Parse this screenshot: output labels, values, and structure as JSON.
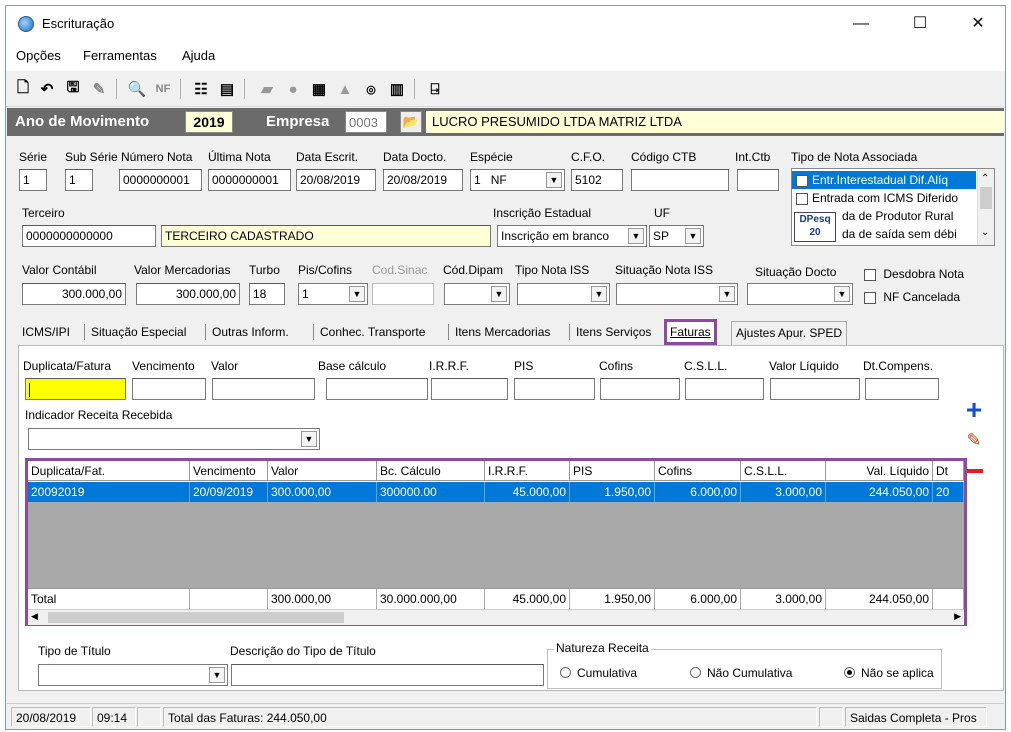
{
  "window": {
    "title": "Escrituração",
    "minimize": "—",
    "maximize": "☐",
    "close": "✕"
  },
  "menu": [
    "Opções",
    "Ferramentas",
    "Ajuda"
  ],
  "yearbar": {
    "ano_label": "Ano de Movimento",
    "ano_value": "2019",
    "empresa_label": "Empresa",
    "empresa_code": "0003",
    "empresa_name": "LUCRO PRESUMIDO LTDA MATRIZ LTDA"
  },
  "header": {
    "serie": {
      "label": "Série",
      "value": "1"
    },
    "sub_serie": {
      "label": "Sub Série",
      "value": "1"
    },
    "numero_nota": {
      "label": "Número Nota",
      "value": "0000000001"
    },
    "ultima_nota": {
      "label": "Última Nota",
      "value": "0000000001"
    },
    "data_escrit": {
      "label": "Data Escrit.",
      "value": "20/08/2019"
    },
    "data_docto": {
      "label": "Data Docto.",
      "value": "20/08/2019"
    },
    "especie": {
      "label": "Espécie",
      "value_code": "1",
      "value_text": "NF"
    },
    "cfo": {
      "label": "C.F.O.",
      "value": "5102"
    },
    "codigo_ctb": {
      "label": "Código CTB",
      "value": ""
    },
    "int_ctb": {
      "label": "Int.Ctb",
      "value": ""
    },
    "tipo_nota": {
      "label": "Tipo de Nota Associada",
      "items": [
        "Entr.Interestadual Dif.Alíq",
        "Entrada com ICMS Diferido",
        "Entrada de Produtor Rural",
        "Entrada de saída sem débi"
      ],
      "item_visible_suffix": [
        "da de Produtor Rural",
        "da de saída sem débi"
      ]
    },
    "dpesq": {
      "line1": "DPesq",
      "line2": "20"
    },
    "terceiro": {
      "label": "Terceiro",
      "code": "0000000000000",
      "name": "TERCEIRO CADASTRADO"
    },
    "inscricao": {
      "label": "Inscrição Estadual",
      "value": "Inscrição em branco"
    },
    "uf": {
      "label": "UF",
      "value": "SP"
    },
    "valor_contabil": {
      "label": "Valor Contábil",
      "value": "300.000,00"
    },
    "valor_mercadorias": {
      "label": "Valor Mercadorias",
      "value": "300.000,00"
    },
    "turbo": {
      "label": "Turbo",
      "value": "18"
    },
    "pis_cofins": {
      "label": "Pis/Cofins",
      "value": "1"
    },
    "cod_sinac": {
      "label": "Cod.Sinac"
    },
    "cod_dipam": {
      "label": "Cód.Dipam"
    },
    "tipo_nota_iss": {
      "label": "Tipo Nota ISS"
    },
    "situacao_nota_iss": {
      "label": "Situação Nota ISS"
    },
    "situacao_docto": {
      "label": "Situação Docto"
    },
    "desdobra_nota": "Desdobra Nota",
    "nf_cancelada": "NF Cancelada"
  },
  "tabs": [
    "ICMS/IPI",
    "Situação Especial",
    "Outras Inform.",
    "Conhec. Transporte",
    "Itens Mercadorias",
    "Itens Serviços",
    "Faturas",
    "Ajustes Apur. SPED"
  ],
  "form": {
    "duplicata": "Duplicata/Fatura",
    "vencimento": "Vencimento",
    "valor": "Valor",
    "base": "Base cálculo",
    "irrf": "I.R.R.F.",
    "pis": "PIS",
    "cofins": "Cofins",
    "csll": "C.S.L.L.",
    "valor_liquido": "Valor Líquido",
    "dt_comp": "Dt.Compens.",
    "indicador": "Indicador Receita Recebida"
  },
  "grid": {
    "columns": [
      "Duplicata/Fat.",
      "Vencimento",
      "Valor",
      "Bc. Cálculo",
      "I.R.R.F.",
      "PIS",
      "Cofins",
      "C.S.L.L.",
      "Val. Líquido",
      "Dt"
    ],
    "row": [
      "20092019",
      "20/09/2019",
      "300.000,00",
      "300000.00",
      "45.000,00",
      "1.950,00",
      "6.000,00",
      "3.000,00",
      "244.050,00",
      "20"
    ],
    "total": [
      "Total",
      "",
      "300.000,00",
      "30.000.000,00",
      "45.000,00",
      "1.950,00",
      "6.000,00",
      "3.000,00",
      "244.050,00",
      ""
    ]
  },
  "bottom": {
    "tipo_titulo": "Tipo de Título",
    "descricao": "Descrição do Tipo de Título",
    "natureza": "Natureza Receita",
    "opt1": "Cumulativa",
    "opt2": "Não Cumulativa",
    "opt3": "Não se aplica",
    "selected": "Não se aplica"
  },
  "status": {
    "date": "20/08/2019",
    "time": "09:14",
    "total": "Total das Faturas: 244.050,00",
    "mode": "Saidas Completa - Pros"
  },
  "colors": {
    "accent": "#0078d7",
    "highlight_border": "#8e4aa0",
    "yellow": "#ffffd8"
  }
}
